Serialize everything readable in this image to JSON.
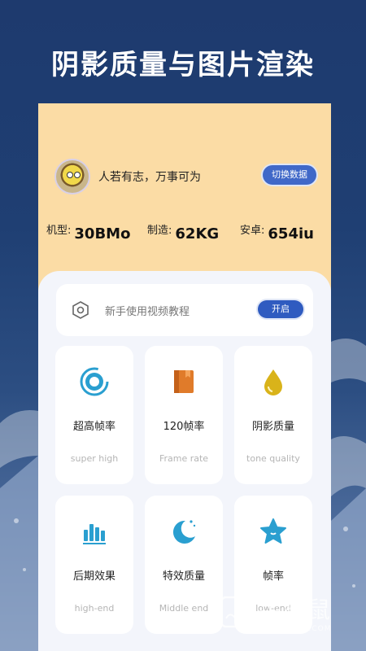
{
  "headline": "阴影质量与图片渲染",
  "profile": {
    "motto": "人若有志，万事可为",
    "switch_label": "切换数据"
  },
  "specs": [
    {
      "label": "机型:",
      "value": "30BMo"
    },
    {
      "label": "制造:",
      "value": "62KG"
    },
    {
      "label": "安卓:",
      "value": "654iu"
    }
  ],
  "tutorial": {
    "text": "新手使用视频教程",
    "button_label": "开启"
  },
  "cards": [
    {
      "name": "超高帧率",
      "en": "super high",
      "icon": "speedometer-icon"
    },
    {
      "name": "120帧率",
      "en": "Frame rate",
      "icon": "book-icon"
    },
    {
      "name": "阴影质量",
      "en": "tone quality",
      "icon": "drop-icon"
    },
    {
      "name": "后期效果",
      "en": "high-end",
      "icon": "bar-chart-icon"
    },
    {
      "name": "特效质量",
      "en": "Middle end",
      "icon": "moon-icon"
    },
    {
      "name": "帧率",
      "en": "low-end",
      "icon": "star-icon"
    }
  ],
  "watermark": {
    "cn": "手机鼠",
    "en": "SHOUJISHU.COM"
  },
  "colors": {
    "background": "#1e3a6e",
    "card_panel": "#fbdca5",
    "accent_blue": "#2f5bc0",
    "icon_blue": "#2a9fd0",
    "icon_orange": "#e07b2a",
    "icon_yellow": "#d9b31a"
  }
}
